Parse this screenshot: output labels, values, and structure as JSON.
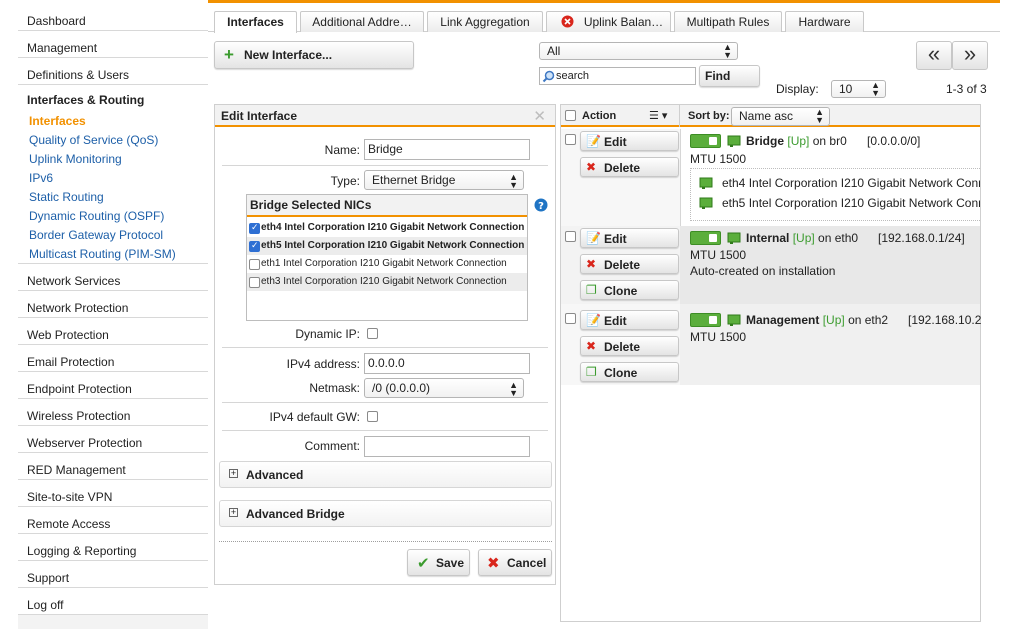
{
  "sidebar": {
    "items_top": [
      "Dashboard",
      "Management",
      "Definitions & Users"
    ],
    "group": {
      "title": "Interfaces & Routing",
      "subitems": [
        "Interfaces",
        "Quality of Service (QoS)",
        "Uplink Monitoring",
        "IPv6",
        "Static Routing",
        "Dynamic Routing (OSPF)",
        "Border Gateway Protocol",
        "Multicast Routing (PIM-SM)"
      ]
    },
    "items_bottom": [
      "Network Services",
      "Network Protection",
      "Web Protection",
      "Email Protection",
      "Endpoint Protection",
      "Wireless Protection",
      "Webserver Protection",
      "RED Management",
      "Site-to-site VPN",
      "Remote Access",
      "Logging & Reporting",
      "Support",
      "Log off"
    ]
  },
  "tabs": [
    "Interfaces",
    "Additional Addre…",
    "Link Aggregation",
    "Uplink Balan…",
    "Multipath Rules",
    "Hardware"
  ],
  "toolbar": {
    "new_interface": "New Interface...",
    "filter_value": "All",
    "search_placeholder": "search",
    "find": "Find",
    "display_label": "Display:",
    "display_value": "10",
    "count": "1-3 of 3",
    "prev": "«",
    "next": "»"
  },
  "edit": {
    "title": "Edit Interface",
    "name_label": "Name:",
    "name_value": "Bridge",
    "type_label": "Type:",
    "type_value": "Ethernet Bridge",
    "nics_title": "Bridge Selected NICs",
    "nics": [
      {
        "label": "eth4 Intel Corporation I210 Gigabit Network Connection",
        "checked": true
      },
      {
        "label": "eth5 Intel Corporation I210 Gigabit Network Connection",
        "checked": true
      },
      {
        "label": "eth1 Intel Corporation I210 Gigabit Network Connection",
        "checked": false
      },
      {
        "label": "eth3 Intel Corporation I210 Gigabit Network Connection",
        "checked": false
      }
    ],
    "dynamic_ip_label": "Dynamic IP:",
    "ipv4_label": "IPv4 address:",
    "ipv4_value": "0.0.0.0",
    "netmask_label": "Netmask:",
    "netmask_value": "/0 (0.0.0.0)",
    "default_gw_label": "IPv4 default GW:",
    "comment_label": "Comment:",
    "advanced": "Advanced",
    "advanced_bridge": "Advanced Bridge",
    "save": "Save",
    "cancel": "Cancel"
  },
  "list": {
    "action_header": "Action",
    "sort_label": "Sort by:",
    "sort_value": "Name asc",
    "edit": "Edit",
    "delete": "Delete",
    "clone": "Clone",
    "rows": [
      {
        "name": "Bridge",
        "status": "[Up]",
        "on": "on br0",
        "ip": "[0.0.0.0/0]",
        "mtu": "MTU 1500",
        "nics": [
          "eth4 Intel Corporation I210 Gigabit Network Conn",
          "eth5 Intel Corporation I210 Gigabit Network Conn"
        ]
      },
      {
        "name": "Internal",
        "status": "[Up]",
        "on": "on eth0",
        "ip": "[192.168.0.1/24]",
        "mtu": "MTU 1500",
        "note": "Auto-created on installation"
      },
      {
        "name": "Management",
        "status": "[Up]",
        "on": "on eth2",
        "ip": "[192.168.10.2",
        "mtu": "MTU 1500"
      }
    ]
  },
  "colors": {
    "accent": "#f29100",
    "link": "#1d5fa8",
    "ok": "#3b9b2e",
    "danger": "#d9261c"
  }
}
